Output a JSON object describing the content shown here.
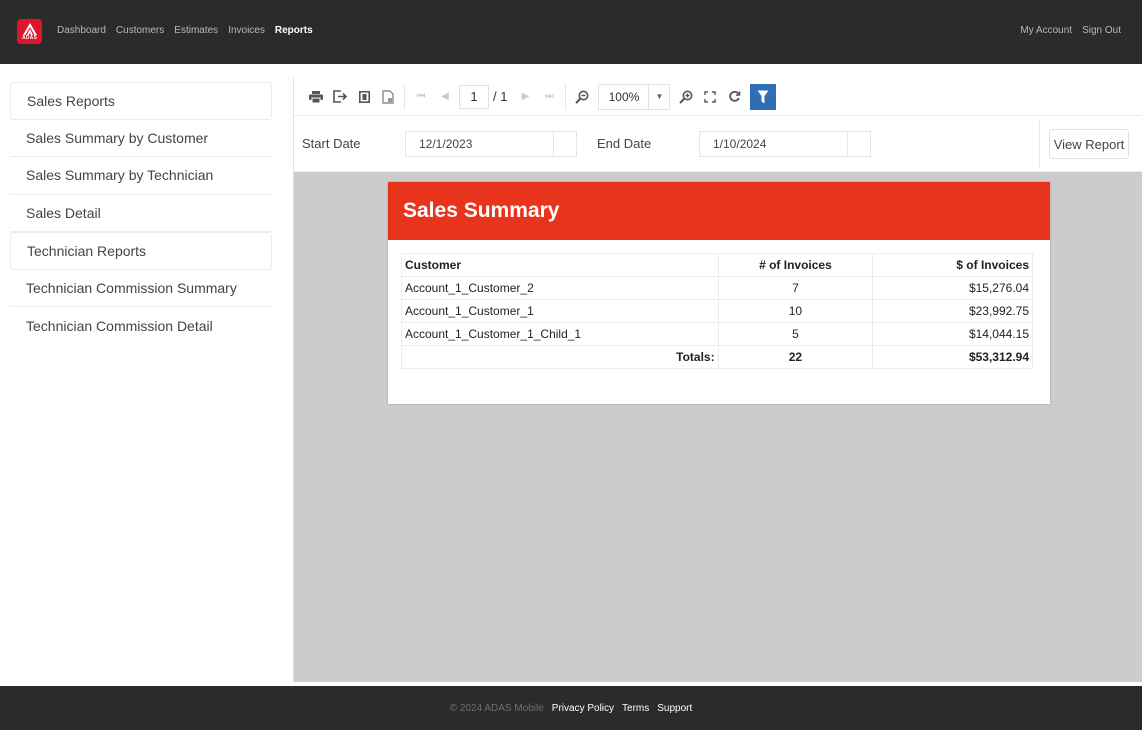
{
  "header": {
    "logo_text": "ADAS",
    "nav": [
      {
        "label": "Dashboard",
        "active": false
      },
      {
        "label": "Customers",
        "active": false
      },
      {
        "label": "Estimates",
        "active": false
      },
      {
        "label": "Invoices",
        "active": false
      },
      {
        "label": "Reports",
        "active": true
      }
    ],
    "account_links": [
      "My Account",
      "Sign Out"
    ]
  },
  "sidebar": {
    "items": [
      {
        "label": "Sales Reports",
        "type": "group"
      },
      {
        "label": "Sales Summary by Customer",
        "type": "item"
      },
      {
        "label": "Sales Summary by Technician",
        "type": "item"
      },
      {
        "label": "Sales Detail",
        "type": "item"
      },
      {
        "label": "Technician Reports",
        "type": "group"
      },
      {
        "label": "Technician Commission Summary",
        "type": "item"
      },
      {
        "label": "Technician Commission Detail",
        "type": "item"
      }
    ]
  },
  "toolbar": {
    "icons": [
      "print-icon",
      "export-icon",
      "single-page-icon",
      "multi-page-icon",
      "first-page-icon",
      "previous-page-icon",
      "next-page-icon",
      "last-page-icon",
      "zoom-out-icon",
      "zoom-in-icon",
      "fullscreen-icon",
      "refresh-icon",
      "filter-icon"
    ],
    "current_page": "1",
    "total_pages": "/ 1",
    "zoom_level": "100%"
  },
  "parameters": {
    "start_label": "Start Date",
    "start_value": "12/1/2023",
    "end_label": "End Date",
    "end_value": "1/10/2024",
    "view_report_label": "View Report"
  },
  "report": {
    "title": "Sales Summary",
    "accent_color": "#e8341c",
    "columns": [
      "Customer",
      "# of Invoices",
      "$ of Invoices"
    ],
    "rows": [
      [
        "Account_1_Customer_2",
        "7",
        "$15,276.04"
      ],
      [
        "Account_1_Customer_1",
        "10",
        "$23,992.75"
      ],
      [
        "Account_1_Customer_1_Child_1",
        "5",
        "$14,044.15"
      ]
    ],
    "totals": {
      "label": "Totals:",
      "count": "22",
      "amount": "$53,312.94"
    }
  },
  "footer": {
    "copyright": "© 2024 ADAS Mobile",
    "links": [
      "Privacy Policy",
      "Terms",
      "Support"
    ]
  }
}
